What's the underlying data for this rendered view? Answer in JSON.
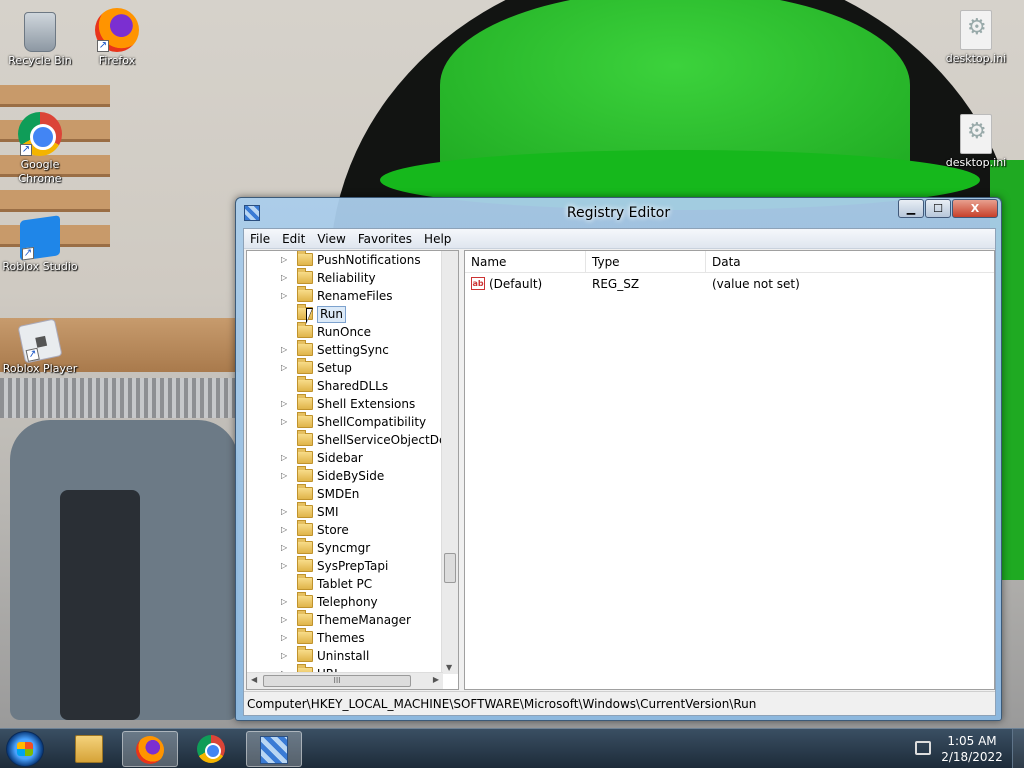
{
  "desktop": {
    "icons": [
      {
        "label": "Recycle Bin",
        "icon": "recycle-bin-icon"
      },
      {
        "label": "Firefox",
        "icon": "firefox-icon"
      },
      {
        "label": "Google Chrome",
        "icon": "chrome-icon"
      },
      {
        "label": "Roblox Studio",
        "icon": "roblox-studio-icon"
      },
      {
        "label": "Roblox Player",
        "icon": "roblox-player-icon"
      },
      {
        "label": "desktop.ini",
        "icon": "settings-file-icon"
      },
      {
        "label": "desktop.ini",
        "icon": "settings-file-icon"
      }
    ]
  },
  "window": {
    "title": "Registry Editor",
    "controls": {
      "minimize": "▁",
      "maximize": "☐",
      "close": "X"
    }
  },
  "menu": [
    "File",
    "Edit",
    "View",
    "Favorites",
    "Help"
  ],
  "tree": {
    "items": [
      {
        "label": "PushNotifications",
        "expander": "▷"
      },
      {
        "label": "Reliability",
        "expander": "▷"
      },
      {
        "label": "RenameFiles",
        "expander": "▷"
      },
      {
        "label": "Run",
        "expander": "",
        "selected": true
      },
      {
        "label": "RunOnce",
        "expander": ""
      },
      {
        "label": "SettingSync",
        "expander": "▷"
      },
      {
        "label": "Setup",
        "expander": "▷"
      },
      {
        "label": "SharedDLLs",
        "expander": ""
      },
      {
        "label": "Shell Extensions",
        "expander": "▷"
      },
      {
        "label": "ShellCompatibility",
        "expander": "▷"
      },
      {
        "label": "ShellServiceObjectDelay",
        "expander": ""
      },
      {
        "label": "Sidebar",
        "expander": "▷"
      },
      {
        "label": "SideBySide",
        "expander": "▷"
      },
      {
        "label": "SMDEn",
        "expander": ""
      },
      {
        "label": "SMI",
        "expander": "▷"
      },
      {
        "label": "Store",
        "expander": "▷"
      },
      {
        "label": "Syncmgr",
        "expander": "▷"
      },
      {
        "label": "SysPrepTapi",
        "expander": "▷"
      },
      {
        "label": "Tablet PC",
        "expander": ""
      },
      {
        "label": "Telephony",
        "expander": "▷"
      },
      {
        "label": "ThemeManager",
        "expander": "▷"
      },
      {
        "label": "Themes",
        "expander": "▷"
      },
      {
        "label": "Uninstall",
        "expander": "▷"
      },
      {
        "label": "URL",
        "expander": "▷"
      }
    ],
    "hscroll_grip": "III"
  },
  "list": {
    "columns": [
      "Name",
      "Type",
      "Data"
    ],
    "rows": [
      {
        "icon": "ab",
        "name": "(Default)",
        "type": "REG_SZ",
        "data": "(value not set)"
      }
    ]
  },
  "statusbar": {
    "path": "Computer\\HKEY_LOCAL_MACHINE\\SOFTWARE\\Microsoft\\Windows\\CurrentVersion\\Run"
  },
  "taskbar": {
    "time": "1:05 AM",
    "date": "2/18/2022"
  }
}
